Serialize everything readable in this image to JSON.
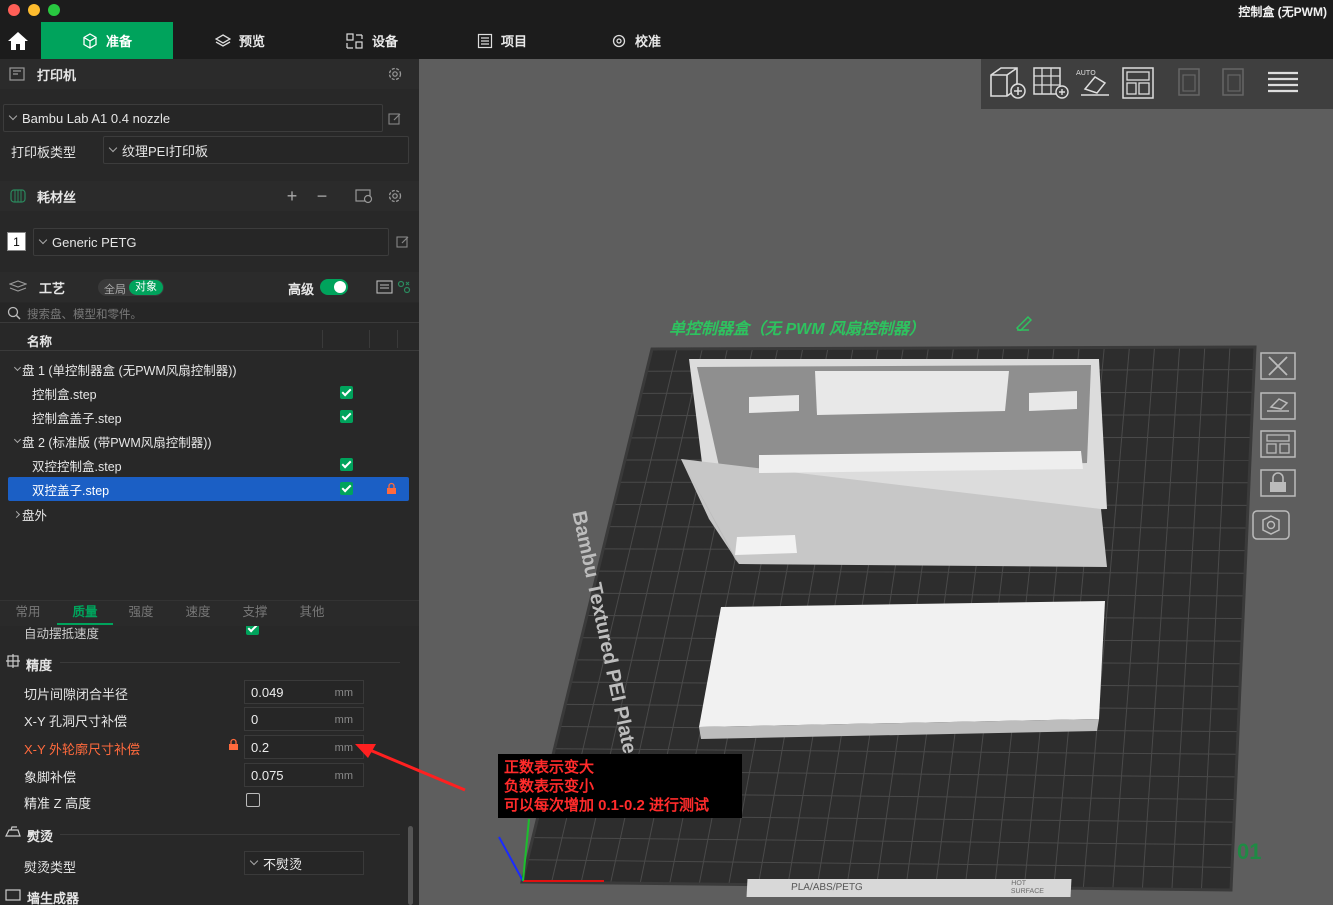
{
  "window": {
    "title": "控制盒 (无PWM)"
  },
  "nav": {
    "tabs": [
      {
        "label": "准备",
        "icon": "cube-icon",
        "active": true
      },
      {
        "label": "预览",
        "icon": "layers-icon"
      },
      {
        "label": "设备",
        "icon": "device-icon"
      },
      {
        "label": "项目",
        "icon": "project-icon"
      },
      {
        "label": "校准",
        "icon": "calibrate-icon"
      }
    ]
  },
  "printer": {
    "section_label": "打印机",
    "preset": "Bambu Lab A1 0.4 nozzle",
    "plate_type_label": "打印板类型",
    "plate_type": "纹理PEI打印板"
  },
  "filament": {
    "section_label": "耗材丝",
    "slot_number": "1",
    "preset": "Generic PETG"
  },
  "process": {
    "section_label": "工艺",
    "toggle_global": "全局",
    "toggle_object": "对象",
    "advanced_label": "高级",
    "search_placeholder": "搜索盘、模型和零件。",
    "name_header": "名称"
  },
  "tree": [
    {
      "label": "盘 1 (单控制器盒 (无PWM风扇控制器))",
      "level": 0,
      "expanded": true
    },
    {
      "label": "控制盒.step",
      "level": 1,
      "checked": true
    },
    {
      "label": "控制盒盖子.step",
      "level": 1,
      "checked": true
    },
    {
      "label": "盘 2 (标准版 (带PWM风扇控制器))",
      "level": 0,
      "expanded": true
    },
    {
      "label": "双控控制盒.step",
      "level": 1,
      "checked": true
    },
    {
      "label": "双控盖子.step",
      "level": 1,
      "checked": true,
      "selected": true,
      "locked": true
    },
    {
      "label": "盘外",
      "level": 0,
      "expanded": false
    }
  ],
  "param_tabs": [
    "常用",
    "质量",
    "强度",
    "速度",
    "支撑",
    "其他"
  ],
  "params": {
    "cut_label": "自动摆抵速度",
    "precision_header": "精度",
    "slice_gap": {
      "label": "切片间隙闭合半径",
      "value": "0.049",
      "unit": "mm"
    },
    "xy_hole": {
      "label": "X-Y 孔洞尺寸补偿",
      "value": "0",
      "unit": "mm"
    },
    "xy_contour": {
      "label": "X-Y 外轮廓尺寸补偿",
      "value": "0.2",
      "unit": "mm"
    },
    "elephant_foot": {
      "label": "象脚补偿",
      "value": "0.075",
      "unit": "mm"
    },
    "precise_z": {
      "label": "精准 Z 高度",
      "checked": false
    },
    "ironing_header": "熨烫",
    "ironing_type": {
      "label": "熨烫类型",
      "value": "不熨烫"
    },
    "wall_gen_header": "墙生成器"
  },
  "viewport": {
    "plate_title": "单控制器盒（无 PWM 风扇控制器）",
    "plate_brand": "Bambu Textured PEI Plate",
    "plate_number": "01",
    "plate_strip_text": "PLA/ABS/PETG",
    "plate_strip_hot": "HOT SURFACE",
    "toolbar_icons": [
      "add-cube-icon",
      "grid-arrange-icon",
      "auto-orient-icon",
      "layout-icon",
      "copy-icon",
      "paste-icon",
      "menu-icon"
    ],
    "side_icons": [
      "close-icon",
      "plate-orient-icon",
      "plate-layout-icon",
      "lock-icon",
      "settings-icon"
    ]
  },
  "annotation": {
    "line1": "正数表示变大",
    "line2": "负数表示变小",
    "line3": "可以每次增加 0.1-0.2 进行测试"
  },
  "colors": {
    "accent": "#00a35c",
    "selection": "#1b5fc5",
    "annotation": "#ff2b2b"
  }
}
